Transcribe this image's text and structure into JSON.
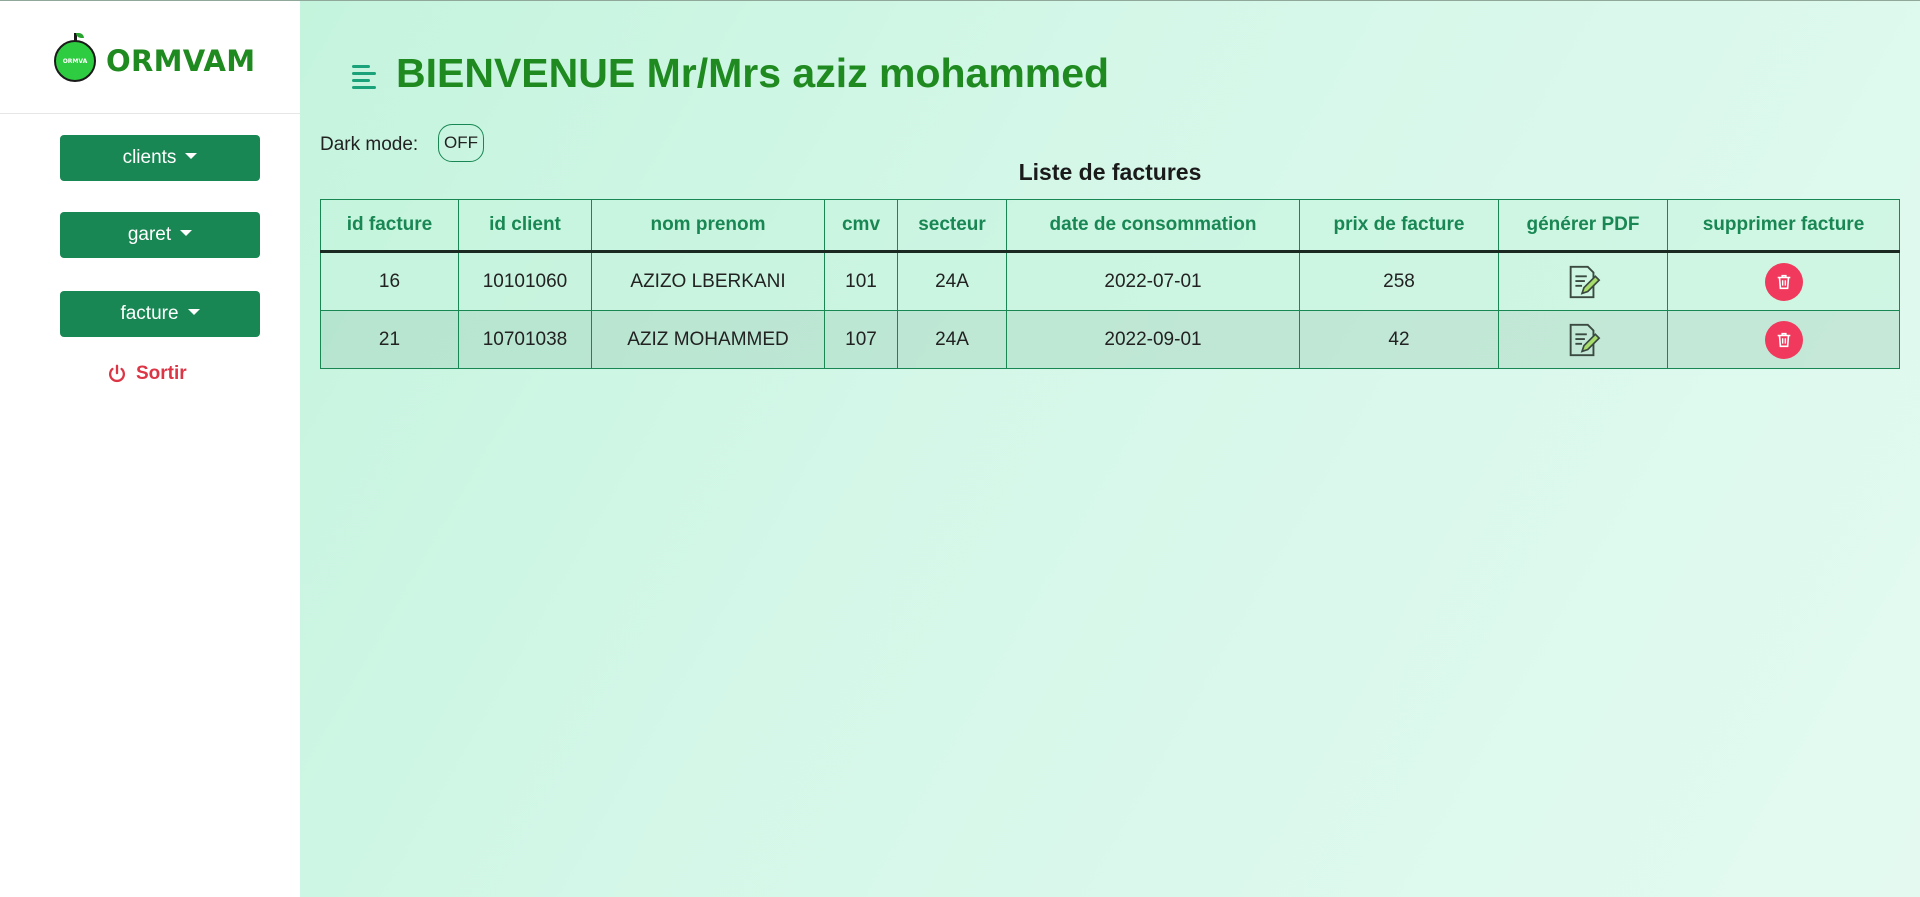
{
  "sidebar": {
    "brand": {
      "name": "ORMVAM",
      "logo_text": "ORMVA"
    },
    "menu": [
      {
        "label": "clients",
        "icon": "caret-down-icon"
      },
      {
        "label": "garet",
        "icon": "caret-down-icon"
      },
      {
        "label": "facture",
        "icon": "caret-down-icon"
      }
    ],
    "logout": {
      "label": "Sortir",
      "icon": "power-icon",
      "color": "#dc3545"
    }
  },
  "header": {
    "title": "BIENVENUE Mr/Mrs aziz mohammed",
    "menu_icon": "menu-icon"
  },
  "dark_mode": {
    "label": "Dark mode:",
    "value": "OFF"
  },
  "invoice_table": {
    "caption": "Liste de factures",
    "columns": [
      "id facture",
      "id client",
      "nom prenom",
      "cmv",
      "secteur",
      "date de consommation",
      "prix de facture",
      "générer PDF",
      "supprimer facture"
    ],
    "rows": [
      {
        "id_facture": "16",
        "id_client": "10101060",
        "nom_prenom": "AZIZO LBERKANI",
        "cmv": "101",
        "secteur": "24A",
        "date": "2022-07-01",
        "prix": "258",
        "pdf_icon": "edit-document-icon",
        "delete_icon": "trash-icon"
      },
      {
        "id_facture": "21",
        "id_client": "10701038",
        "nom_prenom": "AZIZ MOHAMMED",
        "cmv": "107",
        "secteur": "24A",
        "date": "2022-09-01",
        "prix": "42",
        "pdf_icon": "edit-document-icon",
        "delete_icon": "trash-icon"
      }
    ]
  },
  "colors": {
    "brand_green": "#1f8a1f",
    "button_green": "#198754",
    "danger_red": "#dc3545",
    "delete_pink": "#f0395c"
  }
}
